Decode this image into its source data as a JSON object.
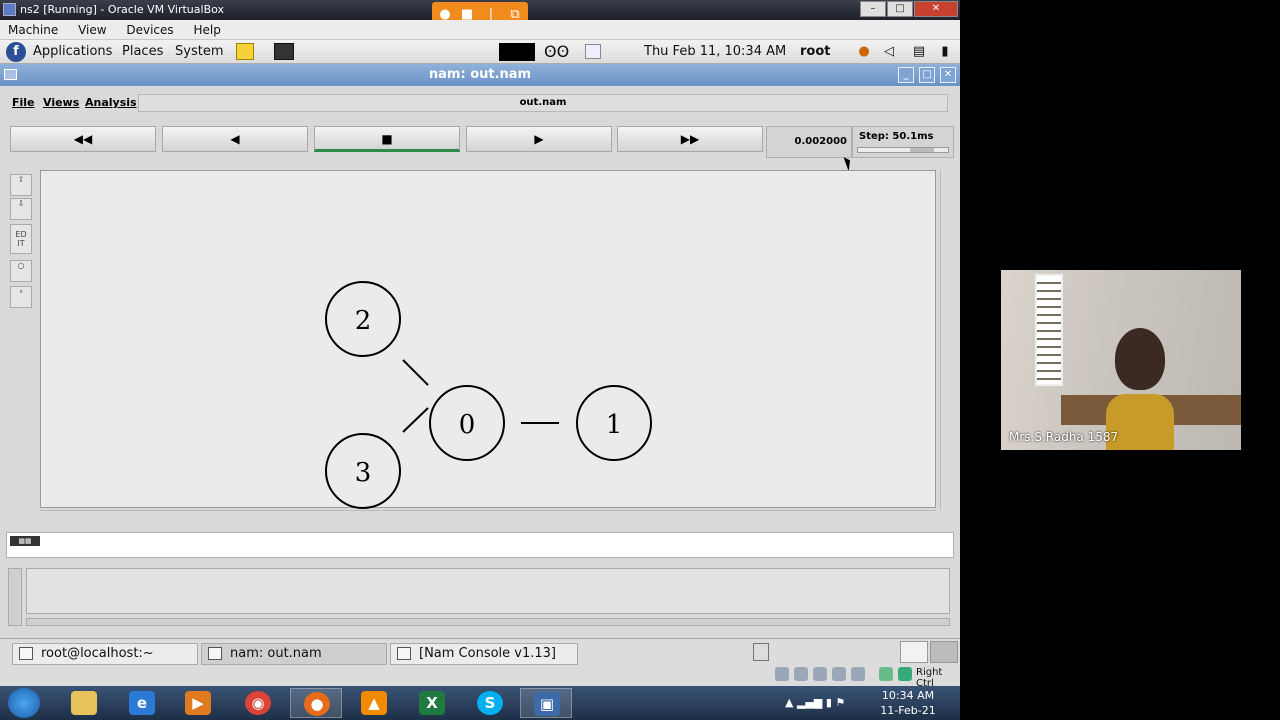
{
  "vbox": {
    "title": "ns2 [Running] - Oracle VM VirtualBox",
    "menu": [
      "Machine",
      "View",
      "Devices",
      "Help"
    ]
  },
  "gnome_panel": {
    "applications": "Applications",
    "places": "Places",
    "system": "System",
    "clock": "Thu Feb 11, 10:34 AM",
    "user": "root"
  },
  "nam": {
    "title": "nam: out.nam",
    "menu": {
      "file": "File",
      "views": "Views",
      "analysis": "Analysis"
    },
    "file_name": "out.nam",
    "transport": {
      "rewind": "◀◀",
      "back": "◀",
      "stop": "■",
      "play": "▶",
      "fast_forward": "▶▶"
    },
    "time": "0.002000",
    "step": "Step: 50.1ms",
    "tools": {
      "edit": "ED IT"
    },
    "nodes": [
      {
        "id": "2"
      },
      {
        "id": "0"
      },
      {
        "id": "1"
      },
      {
        "id": "3"
      }
    ]
  },
  "bottom_panel": {
    "tasks": [
      "root@localhost:~",
      "nam: out.nam",
      "[Nam Console v1.13]"
    ],
    "right_ctrl": "Right Ctrl"
  },
  "windows_taskbar": {
    "time": "10:34 AM",
    "date": "11-Feb-21"
  },
  "webcam": {
    "name": "Mrs.S.Radha 1587"
  }
}
